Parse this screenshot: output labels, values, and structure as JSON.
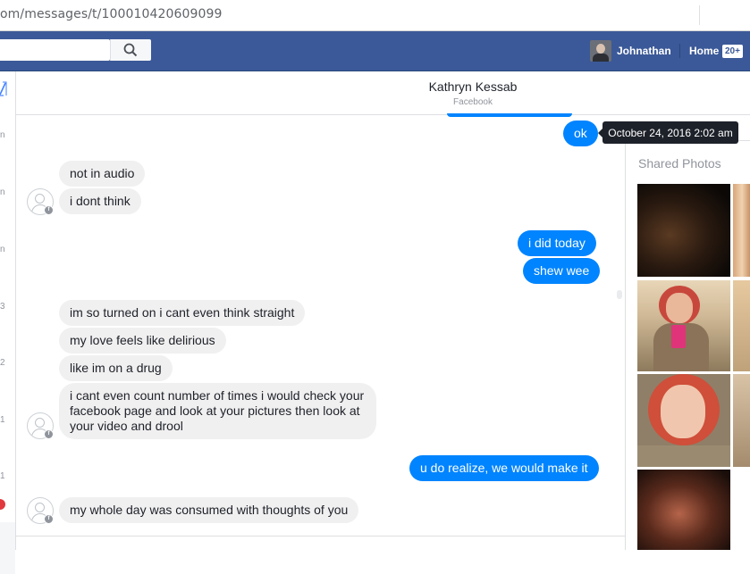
{
  "browser": {
    "url": "om/messages/t/100010420609099"
  },
  "topbar": {
    "user_name": "Johnathan",
    "home_label": "Home",
    "home_badge": "20+"
  },
  "left_strip": {
    "fragments": [
      "n",
      "n",
      "n",
      "3",
      "2",
      "1",
      "1"
    ]
  },
  "conversation": {
    "title": "Kathryn Kessab",
    "subtitle": "Facebook"
  },
  "tooltip": {
    "text": "October 24, 2016 2:02 am"
  },
  "messages": [
    {
      "dir": "out",
      "text": "ok"
    },
    {
      "dir": "in",
      "text": "not in audio"
    },
    {
      "dir": "in",
      "text": "i dont think"
    },
    {
      "dir": "out",
      "text": "i did today"
    },
    {
      "dir": "out",
      "text": "shew wee"
    },
    {
      "dir": "in",
      "text": "im so turned on i cant even think straight"
    },
    {
      "dir": "in",
      "text": "my love feels like delirious"
    },
    {
      "dir": "in",
      "text": "like im on a drug"
    },
    {
      "dir": "in",
      "text": "i cant even count number of times i would check your facebook page and look at your pictures then look at your video and drool"
    },
    {
      "dir": "out",
      "text": "u do realize, we would make it"
    },
    {
      "dir": "in",
      "text": "my whole day was consumed with thoughts of you"
    }
  ],
  "sidebar": {
    "shared_photos_label": "Shared Photos"
  },
  "colors": {
    "facebook_blue": "#3b5998",
    "outgoing_bubble": "#0084ff",
    "incoming_bubble": "#f1f0f0"
  }
}
